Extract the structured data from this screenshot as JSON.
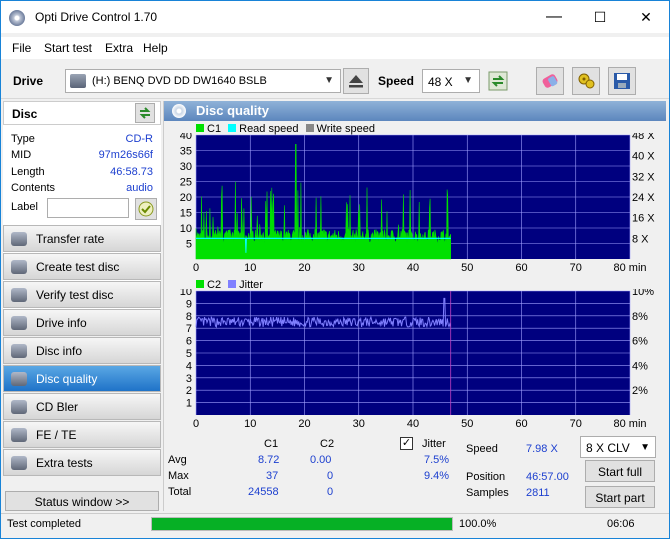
{
  "window": {
    "title": "Opti Drive Control 1.70",
    "minimize": "—",
    "maximize": "☐",
    "close": "✕"
  },
  "menu": [
    "File",
    "Start test",
    "Extra",
    "Help"
  ],
  "toolbar": {
    "drive_label": "Drive",
    "drive_value": "(H:)   BENQ DVD DD DW1640 BSLB",
    "speed_label": "Speed",
    "speed_value": "48 X"
  },
  "disc": {
    "header": "Disc",
    "type_k": "Type",
    "type_v": "CD-R",
    "mid_k": "MID",
    "mid_v": "97m26s66f",
    "length_k": "Length",
    "length_v": "46:58.73",
    "contents_k": "Contents",
    "contents_v": "audio",
    "label_k": "Label",
    "label_v": ""
  },
  "nav": [
    "Transfer rate",
    "Create test disc",
    "Verify test disc",
    "Drive info",
    "Disc info",
    "Disc quality",
    "CD Bler",
    "FE / TE",
    "Extra tests"
  ],
  "nav_selected": "Disc quality",
  "status_window_button": "Status window >>",
  "panel": {
    "title": "Disc quality"
  },
  "legend1": {
    "c1": "C1",
    "read": "Read speed",
    "write": "Write speed"
  },
  "legend2": {
    "c2": "C2",
    "jitter": "Jitter"
  },
  "colors": {
    "c1": "#00e000",
    "read": "#00ffff",
    "write": "#888888",
    "jitter": "#8080ff",
    "plot_bg": "#00007f",
    "grid": "#a0a0ff"
  },
  "chart_data": [
    {
      "type": "line",
      "x_ticks": [
        "0",
        "10",
        "20",
        "30",
        "40",
        "50",
        "60",
        "70",
        "80 min"
      ],
      "y_ticks_left": [
        "5",
        "10",
        "15",
        "20",
        "25",
        "30",
        "35",
        "40"
      ],
      "y_ticks_right": [
        "8 X",
        "16 X",
        "24 X",
        "32 X",
        "40 X",
        "48 X"
      ],
      "xlim": [
        0,
        80
      ],
      "ylim": [
        0,
        40
      ],
      "series": [
        {
          "name": "C1",
          "summary": {
            "avg": 8.72,
            "max": 37,
            "end_min": 46.95
          }
        },
        {
          "name": "Read speed",
          "approx_value_x": 7.98
        }
      ]
    },
    {
      "type": "line",
      "x_ticks": [
        "0",
        "10",
        "20",
        "30",
        "40",
        "50",
        "60",
        "70",
        "80 min"
      ],
      "y_ticks_left": [
        "1",
        "2",
        "3",
        "4",
        "5",
        "6",
        "7",
        "8",
        "9",
        "10"
      ],
      "y_ticks_right": [
        "2%",
        "4%",
        "6%",
        "8%",
        "10%"
      ],
      "xlim": [
        0,
        80
      ],
      "ylim": [
        0,
        10
      ],
      "series": [
        {
          "name": "C2",
          "summary": {
            "avg": 0,
            "max": 0
          }
        },
        {
          "name": "Jitter",
          "summary": {
            "avg_percent": 7.5,
            "max_percent": 9.4
          }
        }
      ]
    }
  ],
  "stats": {
    "col_c1": "C1",
    "col_c2": "C2",
    "avg_k": "Avg",
    "avg_c1": "8.72",
    "avg_c2": "0.00",
    "max_k": "Max",
    "max_c1": "37",
    "max_c2": "0",
    "total_k": "Total",
    "total_c1": "24558",
    "total_c2": "0",
    "jitter_k": "Jitter",
    "jitter_checked": true,
    "jitter_avg": "7.5%",
    "jitter_max": "9.4%",
    "speed_k": "Speed",
    "speed_v": "7.98 X",
    "position_k": "Position",
    "position_v": "46:57.00",
    "samples_k": "Samples",
    "samples_v": "2811",
    "mode_select": "8 X CLV",
    "start_full": "Start full",
    "start_part": "Start part"
  },
  "statusbar": {
    "message": "Test completed",
    "progress_fraction": 1.0,
    "progress_text": "100.0%",
    "time": "06:06"
  }
}
